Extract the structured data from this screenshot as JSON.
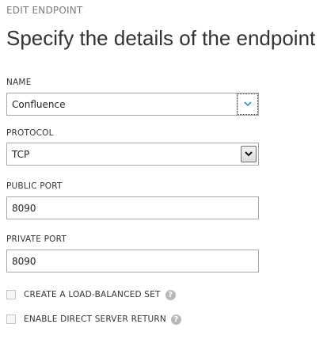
{
  "header": {
    "eyebrow": "EDIT ENDPOINT",
    "title": "Specify the details of the endpoint"
  },
  "form": {
    "name": {
      "label": "NAME",
      "value": "Confluence"
    },
    "protocol": {
      "label": "PROTOCOL",
      "value": "TCP"
    },
    "public_port": {
      "label": "PUBLIC PORT",
      "value": "8090"
    },
    "private_port": {
      "label": "PRIVATE PORT",
      "value": "8090"
    },
    "options": [
      {
        "label": "CREATE A LOAD-BALANCED SET",
        "checked": false,
        "help_icon": "question-icon"
      },
      {
        "label": "ENABLE DIRECT SERVER RETURN",
        "checked": false,
        "help_icon": "question-icon"
      }
    ]
  },
  "colors": {
    "accent": "#2a9fd6",
    "help_icon_bg": "#b9b9b9",
    "field_border": "#a7a7a7"
  },
  "icons": {
    "name_dropdown": "chevron-down-icon",
    "protocol_dropdown": "chevron-down-icon",
    "help": "question-icon"
  },
  "glyphs": {
    "help": "?"
  }
}
